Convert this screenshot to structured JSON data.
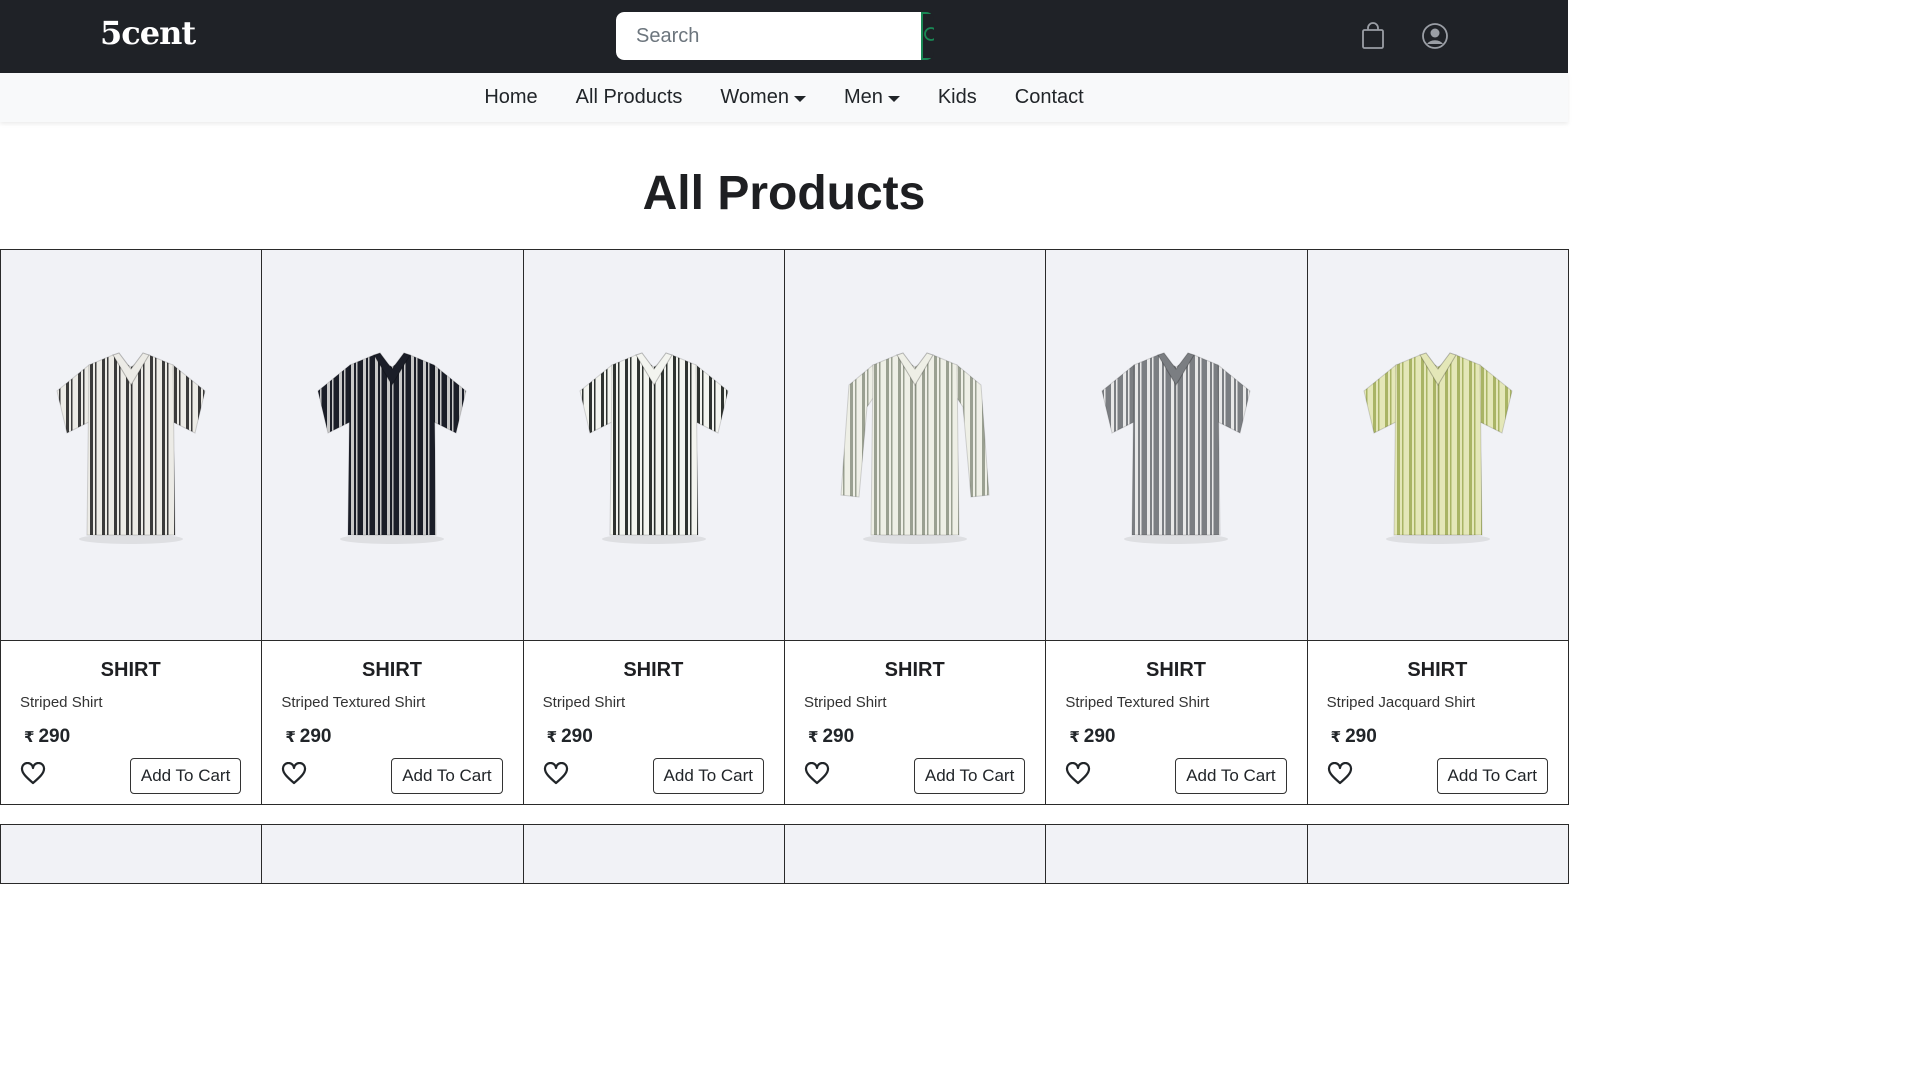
{
  "brand": {
    "logo": "5cent"
  },
  "search": {
    "placeholder": "Search",
    "button_icon": "search-icon"
  },
  "header_icons": [
    "shopping-bag-icon",
    "user-account-icon"
  ],
  "nav": {
    "items": [
      {
        "label": "Home",
        "dropdown": false
      },
      {
        "label": "All Products",
        "dropdown": false
      },
      {
        "label": "Women",
        "dropdown": true
      },
      {
        "label": "Men",
        "dropdown": true
      },
      {
        "label": "Kids",
        "dropdown": false
      },
      {
        "label": "Contact",
        "dropdown": false
      }
    ]
  },
  "page": {
    "title": "All Products"
  },
  "products": [
    {
      "category": "SHIRT",
      "name": "Striped Shirt",
      "currency": "₹",
      "price": "290",
      "button": "Add To Cart",
      "shirt": {
        "base": "#ecebe6",
        "stripe": "#3a3a3a",
        "sleeve": "short"
      }
    },
    {
      "category": "SHIRT",
      "name": "Striped Textured Shirt",
      "currency": "₹",
      "price": "290",
      "button": "Add To Cart",
      "shirt": {
        "base": "#1b1e28",
        "stripe": "#c8c8c8",
        "sleeve": "short"
      }
    },
    {
      "category": "SHIRT",
      "name": "Striped Shirt",
      "currency": "₹",
      "price": "290",
      "button": "Add To Cart",
      "shirt": {
        "base": "#f3f4ef",
        "stripe": "#2f3330",
        "sleeve": "short"
      }
    },
    {
      "category": "SHIRT",
      "name": "Striped Shirt",
      "currency": "₹",
      "price": "290",
      "button": "Add To Cart",
      "shirt": {
        "base": "#eeefe6",
        "stripe": "#9aa091",
        "sleeve": "long"
      }
    },
    {
      "category": "SHIRT",
      "name": "Striped Textured Shirt",
      "currency": "₹",
      "price": "290",
      "button": "Add To Cart",
      "shirt": {
        "base": "#7b7e82",
        "stripe": "#e8e8e8",
        "sleeve": "short"
      }
    },
    {
      "category": "SHIRT",
      "name": "Striped Jacquard Shirt",
      "currency": "₹",
      "price": "290",
      "button": "Add To Cart",
      "shirt": {
        "base": "#e4e7b8",
        "stripe": "#a9b465",
        "sleeve": "short"
      }
    }
  ]
}
